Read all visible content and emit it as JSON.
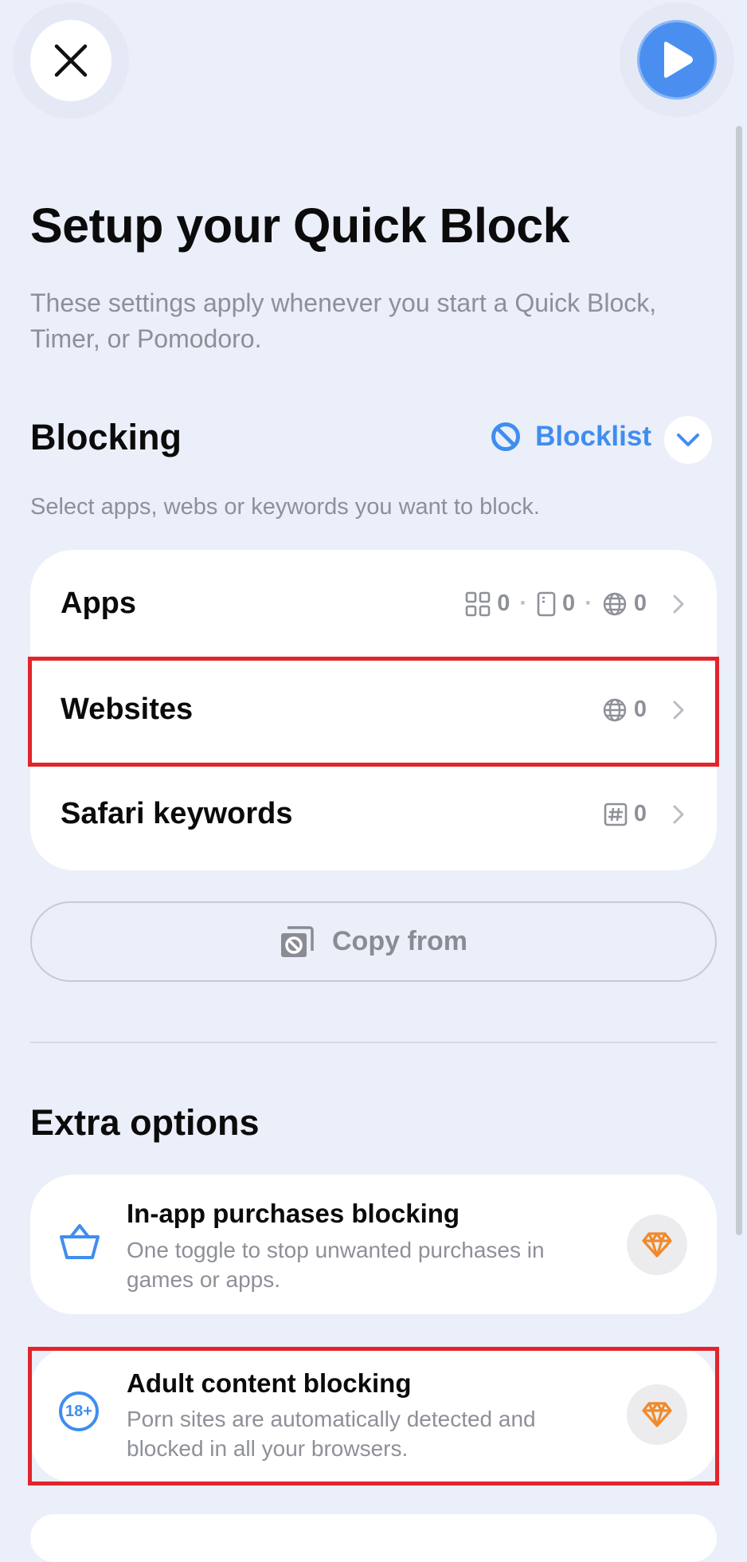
{
  "header": {
    "close_icon": "close-icon",
    "play_icon": "play-icon",
    "title": "Setup your Quick Block",
    "subtitle": "These settings apply whenever you start a Quick Block, Timer, or Pomodoro."
  },
  "blocking": {
    "heading": "Blocking",
    "blocklist_label": "Blocklist",
    "hint": "Select apps, webs or keywords you want to block.",
    "rows": [
      {
        "label": "Apps",
        "counts": [
          "0",
          "0",
          "0"
        ]
      },
      {
        "label": "Websites",
        "counts": [
          "0"
        ]
      },
      {
        "label": "Safari keywords",
        "counts": [
          "0"
        ]
      }
    ],
    "copy_from_label": "Copy from"
  },
  "extra": {
    "heading": "Extra options",
    "options": [
      {
        "title": "In-app purchases blocking",
        "desc": "One toggle to stop unwanted purchases in games or apps."
      },
      {
        "title": "Adult content blocking",
        "desc": "Porn sites are automatically detected and blocked in all your browsers.",
        "badge": "18+"
      }
    ]
  },
  "colors": {
    "accent": "#3f8df0",
    "premium": "#f08a2c",
    "highlight": "#e2242c",
    "background": "#ebeff9"
  }
}
